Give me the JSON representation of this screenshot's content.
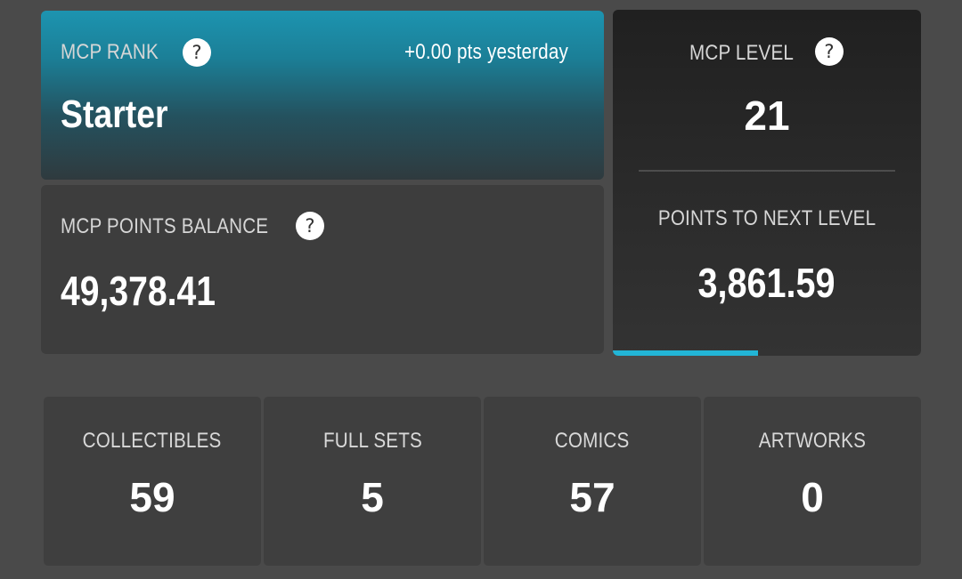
{
  "rank": {
    "label": "MCP RANK",
    "help_icon": "?",
    "change": "+0.00 pts yesterday",
    "value": "Starter"
  },
  "balance": {
    "label": "MCP POINTS BALANCE",
    "help_icon": "?",
    "value": "49,378.41"
  },
  "level": {
    "label": "MCP LEVEL",
    "help_icon": "?",
    "value": "21",
    "next_label": "POINTS TO NEXT LEVEL",
    "next_value": "3,861.59",
    "progress_fraction": 0.47,
    "progress_color": "#22b5d6"
  },
  "stats": [
    {
      "label": "COLLECTIBLES",
      "value": "59"
    },
    {
      "label": "FULL SETS",
      "value": "5"
    },
    {
      "label": "COMICS",
      "value": "57"
    },
    {
      "label": "ARTWORKS",
      "value": "0"
    }
  ],
  "colors": {
    "background": "#4a4a4a",
    "card": "#3d3d3d",
    "rank_gradient_top": "#1d94b0",
    "level_card": "#262626",
    "accent": "#22b5d6"
  }
}
